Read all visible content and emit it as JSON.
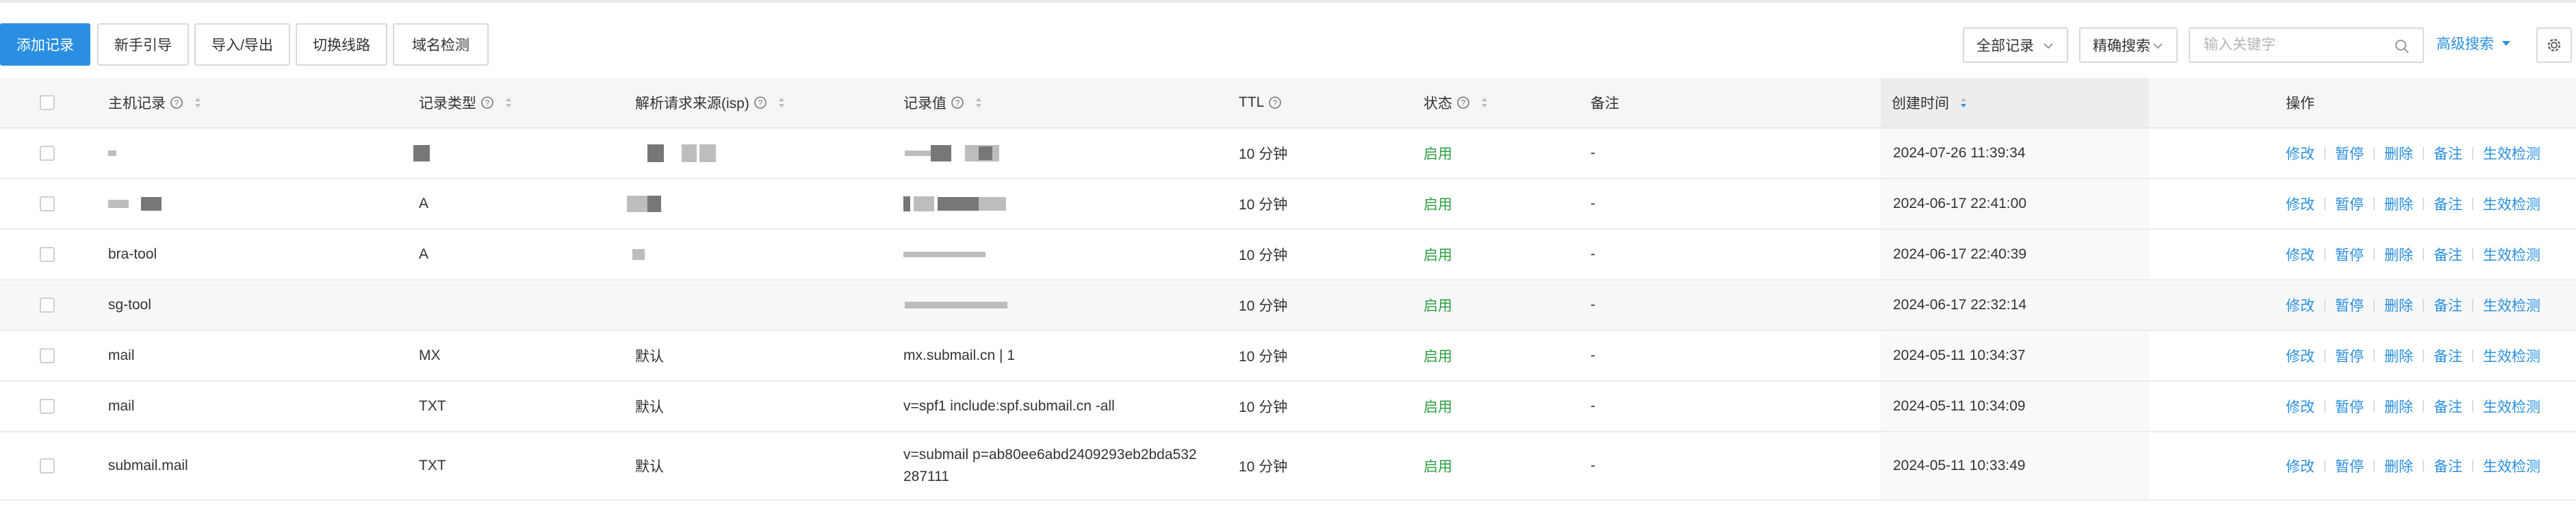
{
  "toolbar": {
    "add_record": "添加记录",
    "guide": "新手引导",
    "import_export": "导入/导出",
    "switch_line": "切换线路",
    "domain_check": "域名检测",
    "filter_all": "全部记录",
    "search_mode": "精确搜索",
    "search_placeholder": "输入关键字",
    "advanced_search": "高级搜索"
  },
  "table": {
    "headers": {
      "host": "主机记录",
      "type": "记录类型",
      "isp": "解析请求来源(isp)",
      "value": "记录值",
      "ttl": "TTL",
      "status": "状态",
      "remark": "备注",
      "created": "创建时间",
      "actions": "操作"
    },
    "actions": [
      "修改",
      "暂停",
      "删除",
      "备注",
      "生效检测"
    ],
    "rows": [
      {
        "host": "",
        "type": "",
        "isp": "",
        "value": "",
        "ttl": "10 分钟",
        "status": "启用",
        "remark": "-",
        "created": "2024-07-26 11:39:34"
      },
      {
        "host": "",
        "type": "A",
        "isp": "",
        "value": "",
        "ttl": "10 分钟",
        "status": "启用",
        "remark": "-",
        "created": "2024-06-17 22:41:00"
      },
      {
        "host": "bra-tool",
        "type": "A",
        "isp": "",
        "value": "",
        "ttl": "10 分钟",
        "status": "启用",
        "remark": "-",
        "created": "2024-06-17 22:40:39"
      },
      {
        "host": "sg-tool",
        "type": "",
        "isp": "",
        "value": "",
        "ttl": "10 分钟",
        "status": "启用",
        "remark": "-",
        "created": "2024-06-17 22:32:14"
      },
      {
        "host": "mail",
        "type": "MX",
        "isp": "默认",
        "value": "mx.submail.cn | 1",
        "ttl": "10 分钟",
        "status": "启用",
        "remark": "-",
        "created": "2024-05-11 10:34:37"
      },
      {
        "host": "mail",
        "type": "TXT",
        "isp": "默认",
        "value": "v=spf1 include:spf.submail.cn -all",
        "ttl": "10 分钟",
        "status": "启用",
        "remark": "-",
        "created": "2024-05-11 10:34:09"
      },
      {
        "host": "submail.mail",
        "type": "TXT",
        "isp": "默认",
        "value": "v=submail p=ab80ee6abd2409293eb2bda532",
        "value2": "287111",
        "ttl": "10 分钟",
        "status": "启用",
        "remark": "-",
        "created": "2024-05-11 10:33:49"
      }
    ]
  },
  "colors": {
    "primary": "#2a8fe2",
    "status_enabled": "#2f9e44",
    "header_bg": "#f5f6f7"
  }
}
